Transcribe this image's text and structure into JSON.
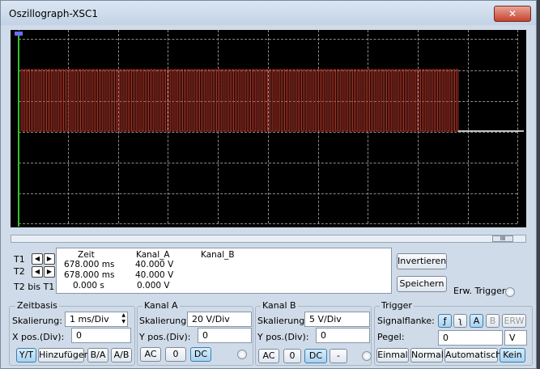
{
  "window": {
    "title": "Oszillograph-XSC1",
    "close_symbol": "✕"
  },
  "scope": {
    "trace_color": "#c0392b",
    "baseline_color": "#ffffff",
    "cursor_color": "#30c030",
    "active_signal_fraction": 0.88
  },
  "scrollbar": {
    "thumb_glyph": "III"
  },
  "readout": {
    "headers": {
      "time": "Zeit",
      "channel_a": "Kanal_A",
      "channel_b": "Kanal_B"
    },
    "rows": [
      {
        "label": "T1",
        "time": "678.000 ms",
        "channel_a": "40.000 V",
        "channel_b": ""
      },
      {
        "label": "T2",
        "time": "678.000 ms",
        "channel_a": "40.000 V",
        "channel_b": ""
      },
      {
        "label": "T2 bis T1",
        "time": "0.000 s",
        "channel_a": "0.000 V",
        "channel_b": ""
      }
    ],
    "arrow_left": "◀",
    "arrow_right": "▶"
  },
  "actions": {
    "invert": "Invertieren",
    "save": "Speichern",
    "ext_trigger": "Erw. Trigger"
  },
  "timebase": {
    "title": "Zeitbasis",
    "scale_label": "Skalierung:",
    "scale_value": "1 ms/Div",
    "xpos_label": "X pos.(Div):",
    "xpos_value": "0",
    "modes": [
      "Y/T",
      "Hinzufügen",
      "B/A",
      "A/B"
    ]
  },
  "channel_a": {
    "title": "Kanal A",
    "scale_label": "Skalierung:",
    "scale_value": "20  V/Div",
    "ypos_label": "Y pos.(Div):",
    "ypos_value": "0",
    "coupling": [
      "AC",
      "0",
      "DC"
    ]
  },
  "channel_b": {
    "title": "Kanal B",
    "scale_label": "Skalierung:",
    "scale_value": "5  V/Div",
    "ypos_label": "Y pos.(Div):",
    "ypos_value": "0",
    "coupling": [
      "AC",
      "0",
      "DC",
      "-"
    ]
  },
  "trigger": {
    "title": "Trigger",
    "edge_label": "Signalflanke:",
    "edge_buttons": [
      "ƒ",
      "ʅ",
      "A",
      "B",
      "ERW"
    ],
    "level_label": "Pegel:",
    "level_value": "0",
    "level_unit": "V",
    "modes": [
      "Einmal",
      "Normal",
      "Automatisch",
      "Kein"
    ]
  }
}
